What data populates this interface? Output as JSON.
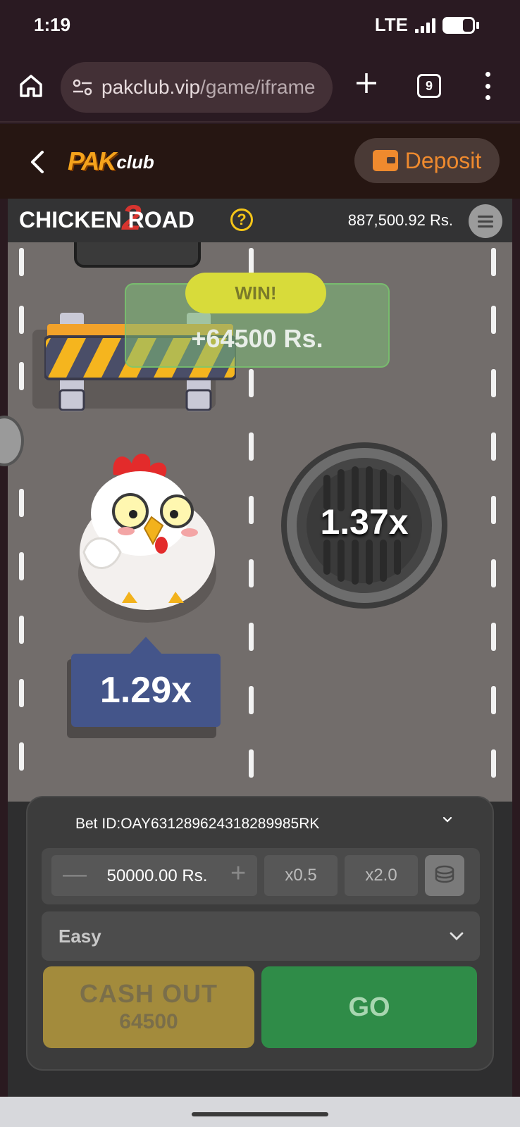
{
  "status_bar": {
    "time": "1:19",
    "network": "LTE"
  },
  "browser": {
    "url_host": "pakclub.vip",
    "url_path": "/game/iframe",
    "tab_count": "9"
  },
  "site_header": {
    "logo_pak": "PAK",
    "logo_club": "club",
    "deposit_label": "Deposit"
  },
  "game": {
    "title": "CHICKEN ROAD",
    "title_number": "2",
    "help_label": "?",
    "balance": "887,500.92 Rs.",
    "win_label": "WIN!",
    "win_amount": "+64500 Rs.",
    "manhole_multiplier": "1.37x",
    "current_multiplier": "1.29x"
  },
  "bet_panel": {
    "bet_id": "Bet ID:OAY631289624318289985RK",
    "stake_value": "50000.00 Rs.",
    "minus_label": "—",
    "plus_label": "+",
    "half_label": "x0.5",
    "double_label": "x2.0",
    "difficulty": "Easy",
    "cashout_label": "CASH OUT",
    "cashout_amount": "64500",
    "go_label": "GO"
  },
  "colors": {
    "deposit_accent": "#ef8a2e",
    "multiplier_box": "#44558a",
    "go_button": "#2f8c48",
    "cashout_button": "#a38b3c",
    "win_pill": "#d8db3a"
  },
  "icons": [
    "home-icon",
    "tune-icon",
    "plus-icon",
    "tabs-icon",
    "kebab-menu-icon",
    "back-icon",
    "wallet-icon",
    "help-icon",
    "menu-icon",
    "chevron-down-icon",
    "coins-icon"
  ]
}
